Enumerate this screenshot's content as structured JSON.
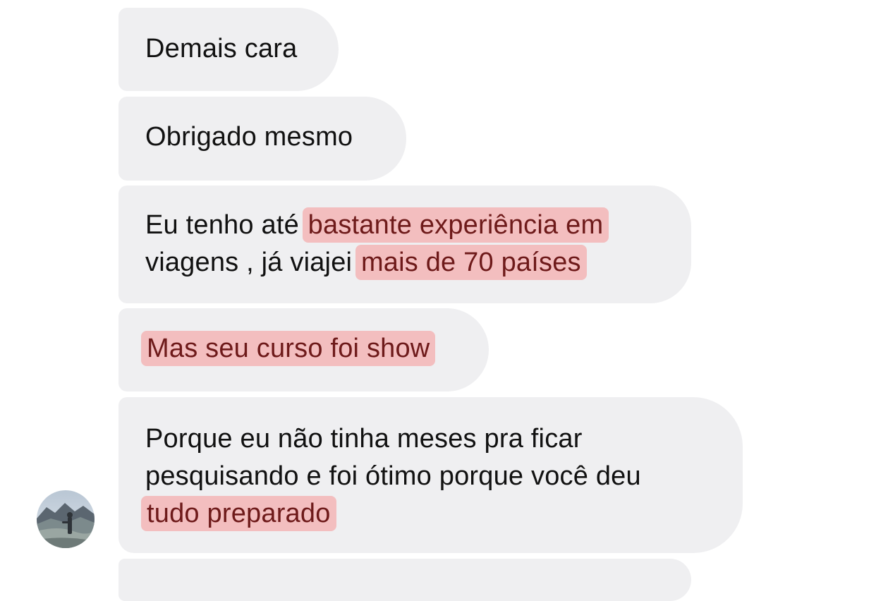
{
  "messages": [
    {
      "id": "m1",
      "segments": [
        {
          "text": "Demais cara",
          "highlight": false
        }
      ]
    },
    {
      "id": "m2",
      "segments": [
        {
          "text": "Obrigado mesmo",
          "highlight": false
        }
      ]
    },
    {
      "id": "m3",
      "segments": [
        {
          "text": "Eu tenho até ",
          "highlight": false
        },
        {
          "text": "bastante experiência em",
          "highlight": true
        },
        {
          "text": "viagens , já viajei ",
          "highlight": false
        },
        {
          "text": "mais de 70 países",
          "highlight": true
        }
      ]
    },
    {
      "id": "m4",
      "segments": [
        {
          "text": "Mas seu curso foi show",
          "highlight": true
        }
      ]
    },
    {
      "id": "m5",
      "segments": [
        {
          "text": "Porque eu não tinha meses pra ficar",
          "highlight": false
        },
        {
          "text": "pesquisando e foi ótimo porque você deu",
          "highlight": false
        },
        {
          "text": "tudo preparado",
          "highlight": true
        }
      ]
    }
  ],
  "avatar": {
    "icon": "contact-avatar-landscape-photo"
  },
  "colors": {
    "bubble": "#efeff1",
    "highlight": "#f69696",
    "highlight_text": "#6e1a1a",
    "text": "#111111"
  }
}
